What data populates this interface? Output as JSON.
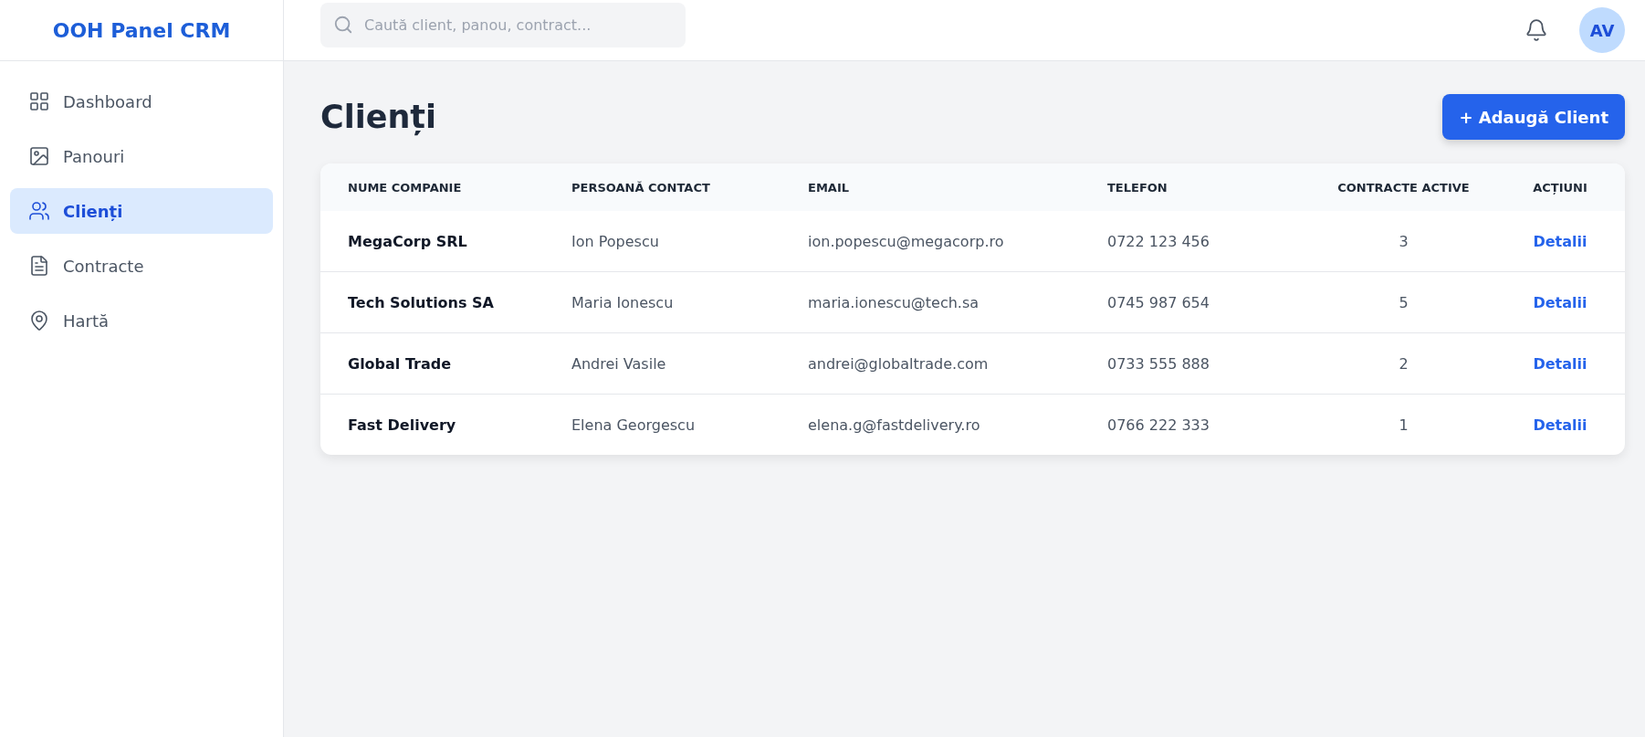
{
  "brand": "OOH Panel CRM",
  "search": {
    "placeholder": "Caută client, panou, contract..."
  },
  "user": {
    "initials": "AV"
  },
  "sidebar": {
    "items": [
      {
        "label": "Dashboard",
        "selected": false
      },
      {
        "label": "Panouri",
        "selected": false
      },
      {
        "label": "Clienți",
        "selected": true
      },
      {
        "label": "Contracte",
        "selected": false
      },
      {
        "label": "Hartă",
        "selected": false
      }
    ]
  },
  "page": {
    "title": "Clienți",
    "add_button": "+ Adaugă Client"
  },
  "table": {
    "columns": [
      "NUME COMPANIE",
      "PERSOANĂ CONTACT",
      "EMAIL",
      "TELEFON",
      "CONTRACTE ACTIVE",
      "ACȚIUNI"
    ],
    "rows": [
      {
        "company": "MegaCorp SRL",
        "contact": "Ion Popescu",
        "email": "ion.popescu@megacorp.ro",
        "phone": "0722 123 456",
        "contracts": "3",
        "action": "Detalii"
      },
      {
        "company": "Tech Solutions SA",
        "contact": "Maria Ionescu",
        "email": "maria.ionescu@tech.sa",
        "phone": "0745 987 654",
        "contracts": "5",
        "action": "Detalii"
      },
      {
        "company": "Global Trade",
        "contact": "Andrei Vasile",
        "email": "andrei@globaltrade.com",
        "phone": "0733 555 888",
        "contracts": "2",
        "action": "Detalii"
      },
      {
        "company": "Fast Delivery",
        "contact": "Elena Georgescu",
        "email": "elena.g@fastdelivery.ro",
        "phone": "0766 222 333",
        "contracts": "1",
        "action": "Detalii"
      }
    ]
  }
}
